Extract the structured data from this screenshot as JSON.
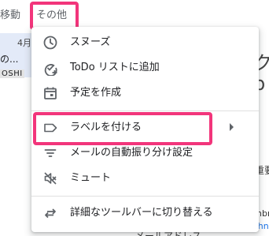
{
  "toolbar": {
    "move_label": "移動",
    "more_label": "その他"
  },
  "email": {
    "date": "4月",
    "snippet": "の...",
    "sender": "OSHI"
  },
  "background": {
    "right_glyph1": "ク",
    "right_glyph2": "p",
    "right_text1": "重要",
    "right_text2": "nbr",
    "right_link": "john",
    "bottom_text": "メールアドレス"
  },
  "menu": {
    "items": [
      {
        "label": "スヌーズ",
        "icon": "clock-icon"
      },
      {
        "label": "ToDo リストに追加",
        "icon": "add-task-icon"
      },
      {
        "label": "予定を作成",
        "icon": "calendar-icon"
      },
      {
        "label": "ラベルを付ける",
        "icon": "label-icon",
        "has_submenu": true
      },
      {
        "label": "メールの自動振り分け設定",
        "icon": "filter-icon"
      },
      {
        "label": "ミュート",
        "icon": "mute-icon"
      },
      {
        "label": "詳細なツールバーに切り替える",
        "icon": "switch-arrows-icon"
      }
    ]
  },
  "colors": {
    "highlight": "#f2357b",
    "icon": "#5f6368",
    "text": "#202124",
    "selected_row_bg": "#e3eaf8"
  }
}
